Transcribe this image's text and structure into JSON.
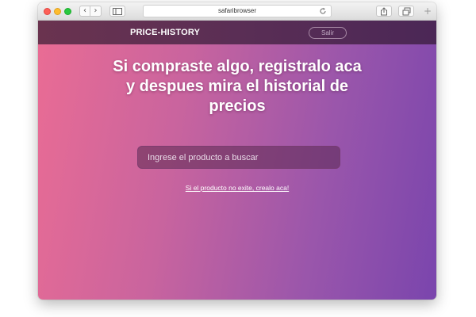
{
  "browser": {
    "address": "safaribrowser",
    "back_icon": "‹",
    "forward_icon": "›",
    "new_tab_icon": "+"
  },
  "navbar": {
    "brand": "PRICE-HISTORY",
    "logout_label": "Salir"
  },
  "hero": {
    "headline": "Si compraste algo, registralo aca y despues mira el historial de precios",
    "search_placeholder": "Ingrese el producto a buscar",
    "create_link": "Si el producto no exite, crealo aca!"
  },
  "colors": {
    "gradient_start": "#ea6c94",
    "gradient_end": "#7a45ad",
    "navbar": "#5a2e55"
  }
}
